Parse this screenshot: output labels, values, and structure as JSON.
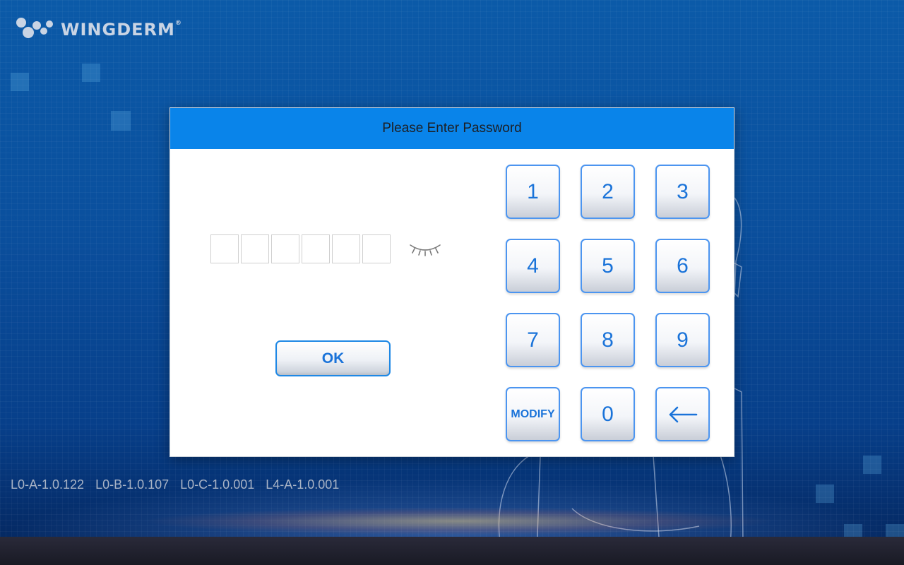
{
  "brand": {
    "name": "WINGDERM",
    "registered_mark": "®"
  },
  "dialog": {
    "title": "Please Enter Password",
    "pin_length": 6,
    "ok_label": "OK"
  },
  "keypad": {
    "keys": [
      "1",
      "2",
      "3",
      "4",
      "5",
      "6",
      "7",
      "8",
      "9",
      "MODIFY",
      "0",
      "backspace"
    ],
    "modify_label": "MODIFY",
    "backspace_icon": "arrow-left-icon"
  },
  "versions": [
    "L0-A-1.0.122",
    "L0-B-1.0.107",
    "L0-C-1.0.001",
    "L4-A-1.0.001"
  ],
  "colors": {
    "header": "#0984ea",
    "accent": "#1a73d9",
    "background": "#0a4f9d"
  }
}
